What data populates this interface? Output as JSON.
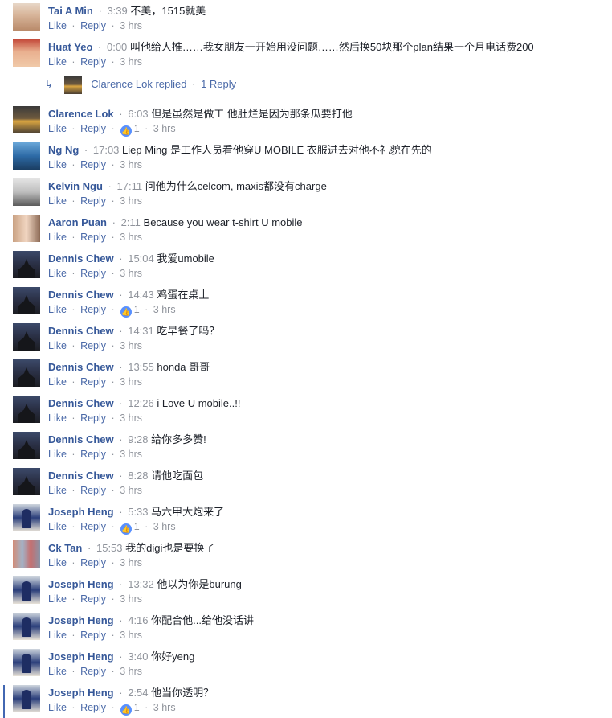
{
  "comments": [
    {
      "author": "Tai A Min",
      "time": "3:39",
      "text": "不美，1515就美",
      "like": "Like",
      "reply": "Reply",
      "age": "3 hrs",
      "likes": "",
      "avatar": "av-person"
    },
    {
      "author": "Huat Yeo",
      "time": "0:00",
      "text": "叫他给人推……我女朋友一开始用没问题……然后换50块那个plan结果一个月电话费200",
      "like": "Like",
      "reply": "Reply",
      "age": "3 hrs",
      "likes": "",
      "avatar": "av-child"
    },
    {
      "author": "Clarence Lok",
      "time": "6:03",
      "text": "但是虽然是做工 他肚烂是因为那条瓜要打他",
      "like": "Like",
      "reply": "Reply",
      "age": "3 hrs",
      "likes": "1",
      "avatar": "av-sunset"
    },
    {
      "author": "Ng Ng",
      "time": "17:03",
      "text": "Liep Ming 是工作人员看他穿U MOBILE 衣服进去对他不礼貌在先的",
      "like": "Like",
      "reply": "Reply",
      "age": "3 hrs",
      "likes": "",
      "avatar": "av-sky"
    },
    {
      "author": "Kelvin Ngu",
      "time": "17:11",
      "text": "问他为什么celcom, maxis都没有charge",
      "like": "Like",
      "reply": "Reply",
      "age": "3 hrs",
      "likes": "",
      "avatar": "av-mask"
    },
    {
      "author": "Aaron Puan",
      "time": "2:11",
      "text": "Because you wear t-shirt U mobile",
      "like": "Like",
      "reply": "Reply",
      "age": "3 hrs",
      "likes": "",
      "avatar": "av-couple"
    },
    {
      "author": "Dennis Chew",
      "time": "15:04",
      "text": "我爱umobile",
      "like": "Like",
      "reply": "Reply",
      "age": "3 hrs",
      "likes": "",
      "avatar": "av-temple"
    },
    {
      "author": "Dennis Chew",
      "time": "14:43",
      "text": "鸡蛋在桌上",
      "like": "Like",
      "reply": "Reply",
      "age": "3 hrs",
      "likes": "1",
      "avatar": "av-temple"
    },
    {
      "author": "Dennis Chew",
      "time": "14:31",
      "text": "吃早餐了吗？",
      "like": "Like",
      "reply": "Reply",
      "age": "3 hrs",
      "likes": "",
      "avatar": "av-temple"
    },
    {
      "author": "Dennis Chew",
      "time": "13:55",
      "text": "honda 哥哥",
      "like": "Like",
      "reply": "Reply",
      "age": "3 hrs",
      "likes": "",
      "avatar": "av-temple"
    },
    {
      "author": "Dennis Chew",
      "time": "12:26",
      "text": "i Love U mobile..!!",
      "like": "Like",
      "reply": "Reply",
      "age": "3 hrs",
      "likes": "",
      "avatar": "av-temple"
    },
    {
      "author": "Dennis Chew",
      "time": "9:28",
      "text": "给你多多赞!",
      "like": "Like",
      "reply": "Reply",
      "age": "3 hrs",
      "likes": "",
      "avatar": "av-temple"
    },
    {
      "author": "Dennis Chew",
      "time": "8:28",
      "text": "请他吃面包",
      "like": "Like",
      "reply": "Reply",
      "age": "3 hrs",
      "likes": "",
      "avatar": "av-temple"
    },
    {
      "author": "Joseph Heng",
      "time": "5:33",
      "text": "马六甲大炮来了",
      "like": "Like",
      "reply": "Reply",
      "age": "3 hrs",
      "likes": "1",
      "avatar": "av-runner"
    },
    {
      "author": "Ck Tan",
      "time": "15:53",
      "text": "我的digi也是要换了",
      "like": "Like",
      "reply": "Reply",
      "age": "3 hrs",
      "likes": "",
      "avatar": "av-group"
    },
    {
      "author": "Joseph Heng",
      "time": "13:32",
      "text": "他以为你是burung",
      "like": "Like",
      "reply": "Reply",
      "age": "3 hrs",
      "likes": "",
      "avatar": "av-runner"
    },
    {
      "author": "Joseph Heng",
      "time": "4:16",
      "text": "你配合他...给他没话讲",
      "like": "Like",
      "reply": "Reply",
      "age": "3 hrs",
      "likes": "",
      "avatar": "av-runner"
    },
    {
      "author": "Joseph Heng",
      "time": "3:40",
      "text": "你好yeng",
      "like": "Like",
      "reply": "Reply",
      "age": "3 hrs",
      "likes": "",
      "avatar": "av-runner"
    },
    {
      "author": "Joseph Heng",
      "time": "2:54",
      "text": "他当你透明？",
      "like": "Like",
      "reply": "Reply",
      "age": "3 hrs",
      "likes": "1",
      "avatar": "av-runner"
    }
  ],
  "replies_summary": {
    "name": "Clarence Lok replied",
    "count": "1 Reply"
  },
  "colors": {
    "link": "#365899",
    "meta": "#90949c",
    "like_badge": "#5890ff"
  }
}
